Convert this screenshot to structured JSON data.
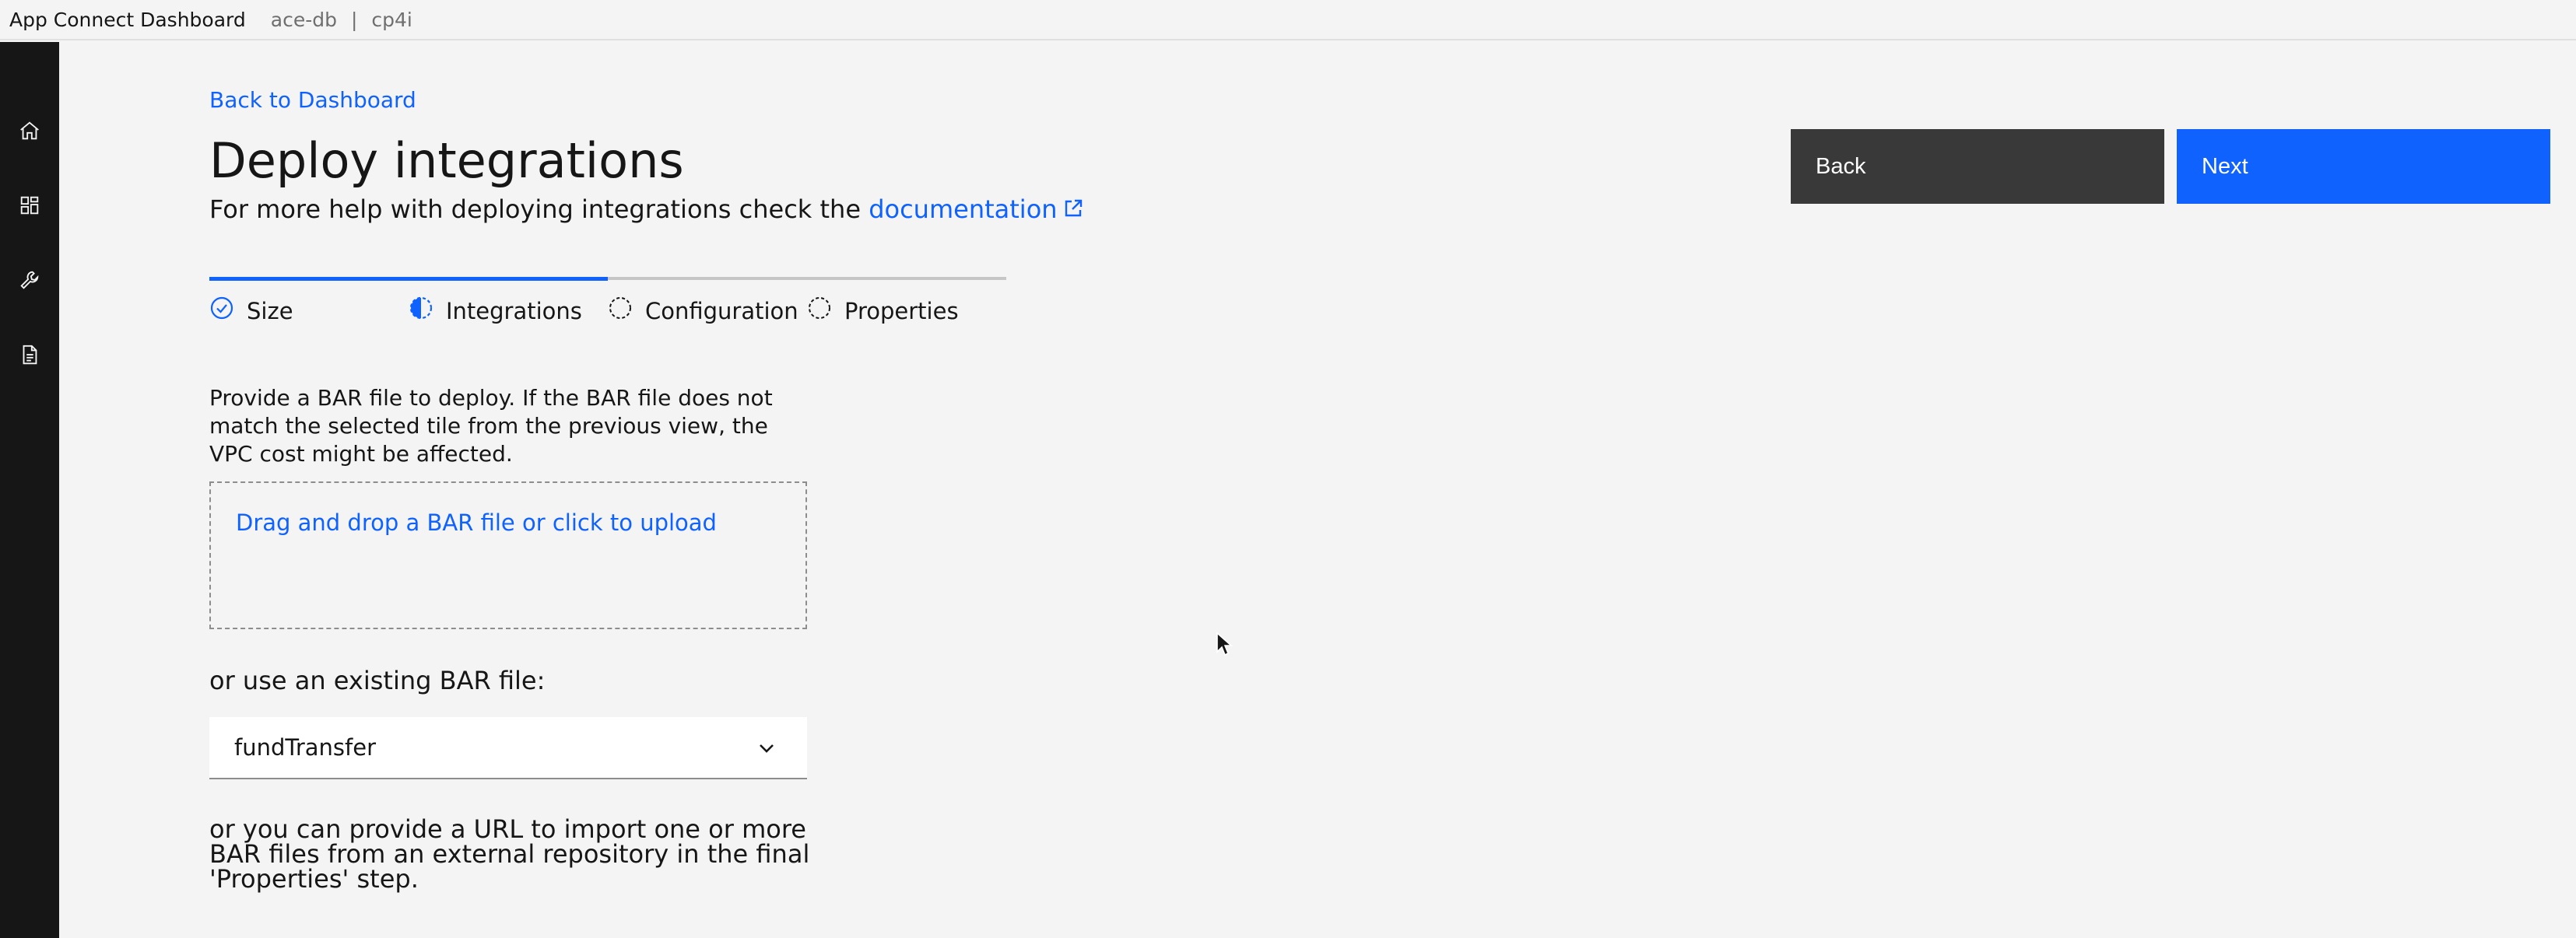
{
  "header": {
    "app_name": "App Connect Dashboard",
    "context_1": "ace-db",
    "separator": "|",
    "context_2": "cp4i"
  },
  "sidebar": {
    "items": [
      {
        "name": "home-icon"
      },
      {
        "name": "dashboard-icon"
      },
      {
        "name": "wrench-icon"
      },
      {
        "name": "document-icon"
      }
    ]
  },
  "page": {
    "back_link": "Back to Dashboard",
    "title": "Deploy integrations",
    "subtitle_prefix": "For more help with deploying integrations check the ",
    "subtitle_link": "documentation"
  },
  "actions": {
    "back_label": "Back",
    "next_label": "Next"
  },
  "progress": {
    "steps": [
      {
        "label": "Size",
        "state": "complete"
      },
      {
        "label": "Integrations",
        "state": "current"
      },
      {
        "label": "Configuration",
        "state": "incomplete"
      },
      {
        "label": "Properties",
        "state": "incomplete"
      }
    ]
  },
  "form": {
    "description": "Provide a BAR file to deploy. If the BAR file does not match the selected tile from the previous view, the VPC cost might be affected.",
    "dropzone_label": "Drag and drop a BAR file or click to upload",
    "existing_label": "or use an existing BAR file:",
    "existing_selected": "fundTransfer",
    "url_note": "or you can provide a URL to import one or more BAR files from an external repository in the final 'Properties' step."
  },
  "colors": {
    "accent": "#0f62fe",
    "sidebar_bg": "#161616",
    "page_bg": "#f4f4f4",
    "back_button_bg": "#393939"
  }
}
